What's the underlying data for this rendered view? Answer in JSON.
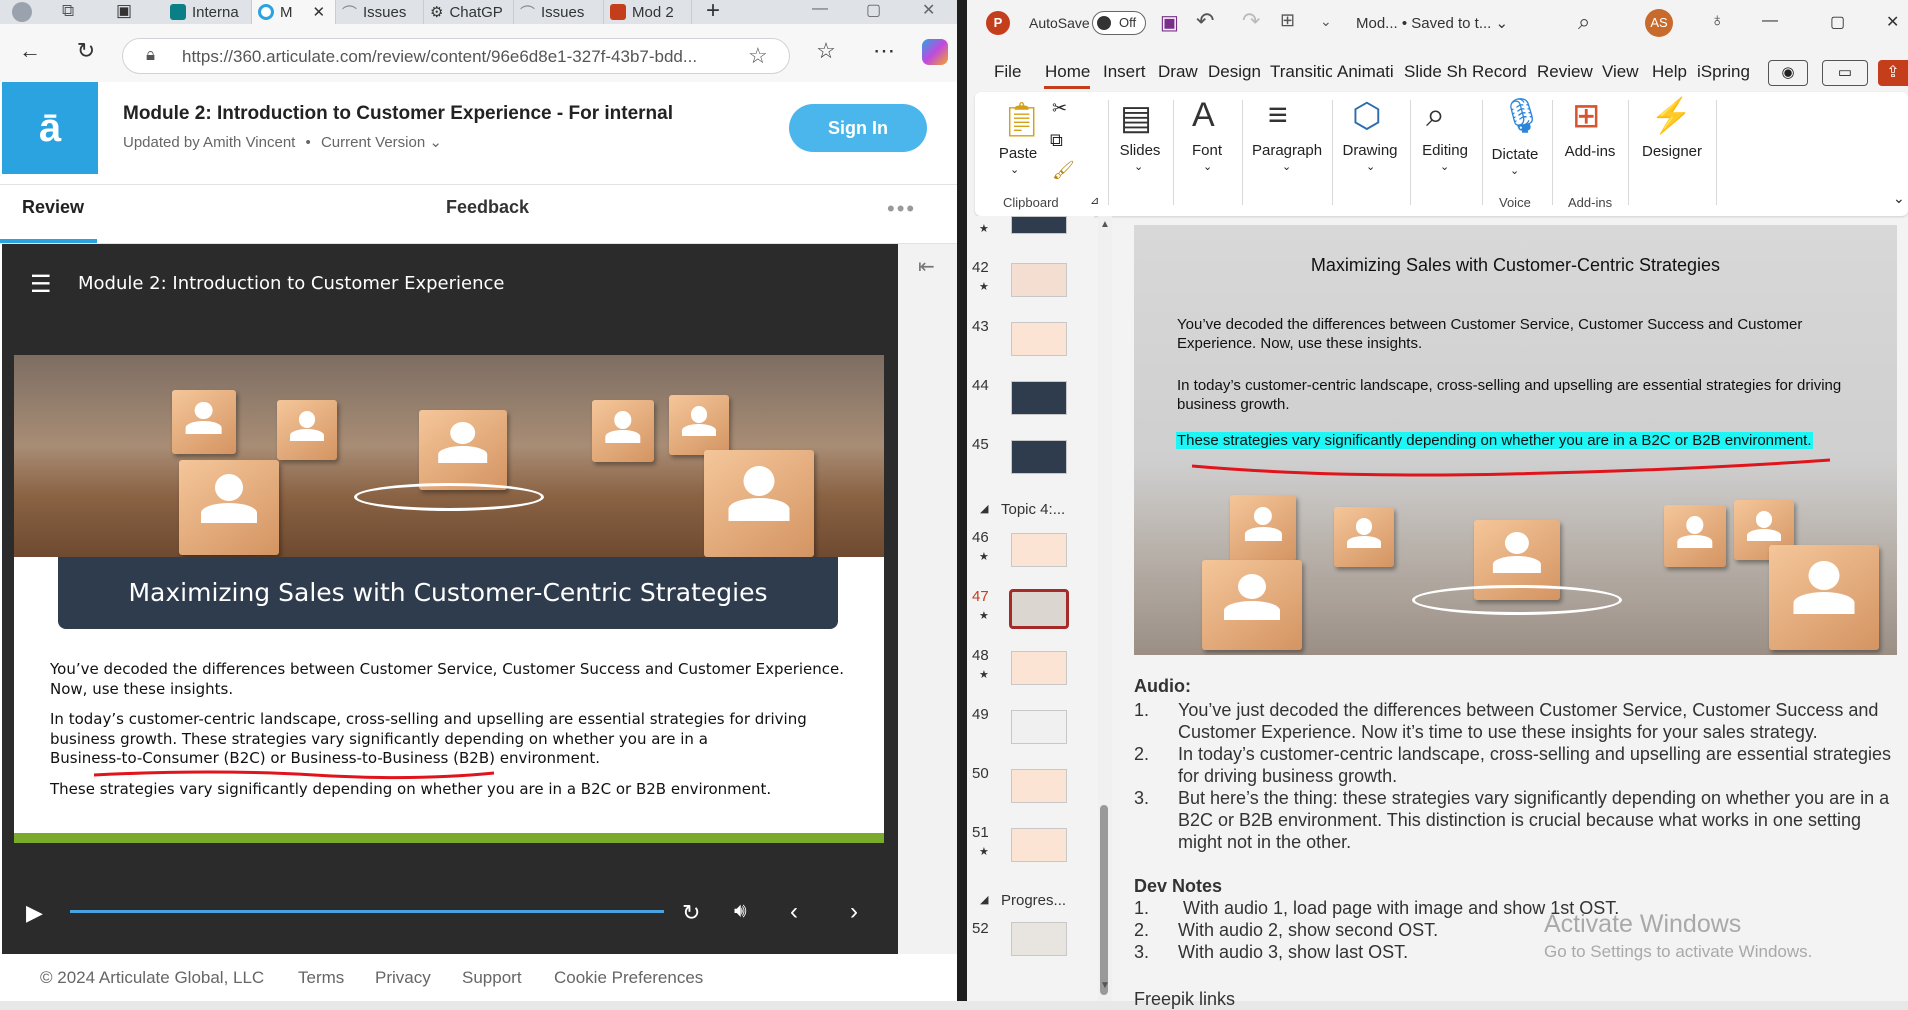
{
  "browser": {
    "tabs": [
      {
        "label": "Interna",
        "icon": "sharepoint-icon"
      },
      {
        "label": "M",
        "icon": "circle-icon"
      },
      {
        "label": "Issues",
        "icon": "issues-icon"
      },
      {
        "label": "ChatGP",
        "icon": "chatgpt-icon"
      },
      {
        "label": "Issues",
        "icon": "issues-icon"
      },
      {
        "label": "Mod 2",
        "icon": "powerpoint-icon"
      }
    ],
    "new_tab": "+",
    "url": "https://360.articulate.com/review/content/96e6d8e1-327f-43b7-bdd..."
  },
  "review": {
    "logo": "ā",
    "title": "Module 2: Introduction to Customer Experience - For internal",
    "updated_by": "Updated by Amith Vincent",
    "bullet": "•",
    "version": "Current Version ⌄",
    "sign_in": "Sign In",
    "tabs": {
      "review": "Review",
      "feedback": "Feedback",
      "more": "•••"
    }
  },
  "player": {
    "title": "Module 2: Introduction to Customer Experience",
    "slide": {
      "title": "Maximizing Sales with Customer-Centric Strategies",
      "p1": "You’ve decoded the differences between Customer Service, Customer Success and Customer Experience. Now, use these insights.",
      "p2a": "In today’s customer-centric landscape, cross-selling and upselling are essential strategies for driving",
      "p2b": "business growth. These strategies vary significantly depending on whether you are in a",
      "p2c": "Business-to-Consumer (B2C) or Business-to-Business (B2B) environment.",
      "p3": "These strategies vary significantly depending on whether you are in a B2C or B2B environment."
    },
    "progress": 0
  },
  "footer": {
    "copyright": "© 2024 Articulate Global, LLC",
    "links": [
      "Terms",
      "Privacy",
      "Support",
      "Cookie Preferences"
    ]
  },
  "ppt": {
    "autosave_label": "AutoSave",
    "autosave_state": "Off",
    "doc_title": "Mod... • Saved to t... ⌄",
    "avatar": "AS",
    "menu": [
      "File",
      "Home",
      "Insert",
      "Draw",
      "Design",
      "Transitio",
      "Animati",
      "Slide Sh",
      "Record",
      "Review",
      "View",
      "Help",
      "iSpring"
    ],
    "ribbon": {
      "paste": "Paste",
      "clipboard": "Clipboard",
      "slides": "Slides",
      "font": "Font",
      "paragraph": "Paragraph",
      "drawing": "Drawing",
      "editing": "Editing",
      "dictate": "Dictate",
      "voice": "Voice",
      "addins": "Add-ins",
      "addins_group": "Add-ins",
      "designer": "Designer"
    },
    "thumbs": [
      {
        "num": "42"
      },
      {
        "num": "43"
      },
      {
        "num": "44"
      },
      {
        "num": "45"
      },
      {
        "num": "46"
      },
      {
        "num": "47"
      },
      {
        "num": "48"
      },
      {
        "num": "49"
      },
      {
        "num": "50"
      },
      {
        "num": "51"
      },
      {
        "num": "52"
      }
    ],
    "sections": [
      "Topic 4:...",
      "Progres..."
    ],
    "selected_slide": "47",
    "slide": {
      "title": "Maximizing Sales with Customer-Centric Strategies",
      "p1": "You’ve decoded the differences between Customer Service, Customer Success and Customer Experience. Now, use these insights.",
      "p2": "In today’s customer-centric landscape, cross-selling and upselling are essential strategies for driving business growth.",
      "p3": "These strategies vary significantly depending on whether you are in a B2C or B2B environment."
    },
    "notes": {
      "audio_heading": "Audio:",
      "audio": [
        {
          "n": "1.",
          "text": "You’ve just decoded the differences between Customer Service, Customer Success and Customer Experience. Now it’s time to use these insights for your sales strategy."
        },
        {
          "n": "2.",
          "text": "In today’s customer-centric landscape, cross-selling and upselling are essential strategies for driving business growth."
        },
        {
          "n": "3.",
          "text": "But here’s the thing: these strategies vary significantly depending on whether you are in a B2C or B2B environment. This distinction is crucial because what works in one setting might not in the other."
        }
      ],
      "dev_heading": "Dev Notes",
      "dev": [
        {
          "n": "1.",
          "text": " With audio 1, load page with image and show 1st OST."
        },
        {
          "n": "2.",
          "text": "With audio 2, show second OST."
        },
        {
          "n": "3.",
          "text": "With audio 3, show last OST."
        }
      ],
      "cut_off": "Freepik links"
    },
    "watermark": {
      "title": "Activate Windows",
      "sub": "Go to Settings to activate Windows."
    }
  }
}
